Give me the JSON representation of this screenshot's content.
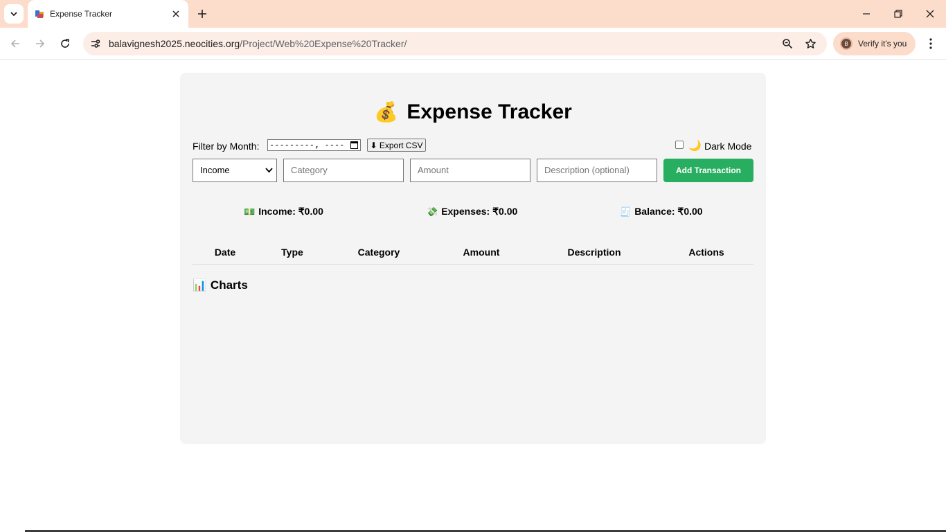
{
  "browser": {
    "tab_title": "Expense Tracker",
    "url_host": "balavignesh2025.neocities.org",
    "url_path": "/Project/Web%20Expense%20Tracker/",
    "verify_label": "Verify it's you",
    "avatar_letter": "B",
    "icons": [
      "tab-search-icon",
      "favicon-icon",
      "close-icon",
      "new-tab-icon",
      "minimize-icon",
      "restore-icon",
      "close-window-icon",
      "back-icon",
      "forward-icon",
      "reload-icon",
      "site-info-icon",
      "zoom-icon",
      "bookmark-star-icon",
      "kebab-menu-icon"
    ]
  },
  "app": {
    "title_emoji": "💰",
    "title": "Expense Tracker",
    "filter": {
      "label": "Filter by Month:",
      "month_placeholder": "---------, ----",
      "export_label": "⬇ Export CSV"
    },
    "dark_mode": {
      "emoji": "🌙",
      "label": "Dark Mode",
      "checked": false
    },
    "form": {
      "type_value": "Income",
      "type_arrow": "⌄",
      "category_placeholder": "Category",
      "amount_placeholder": "Amount",
      "description_placeholder": "Description (optional)",
      "add_label": "Add Transaction"
    },
    "summary": {
      "income_icon": "💵",
      "income": "Income: ₹0.00",
      "expenses_icon": "💸",
      "expenses": "Expenses: ₹0.00",
      "balance_icon": "🧾",
      "balance": "Balance: ₹0.00"
    },
    "table": {
      "headers": [
        "Date",
        "Type",
        "Category",
        "Amount",
        "Description",
        "Actions"
      ]
    },
    "charts": {
      "icon": "📊",
      "title": "Charts"
    },
    "colors": {
      "accent_green": "#27ae60",
      "card_bg": "#f4f4f4",
      "chrome_tab_bg": "#fcdccb"
    }
  }
}
